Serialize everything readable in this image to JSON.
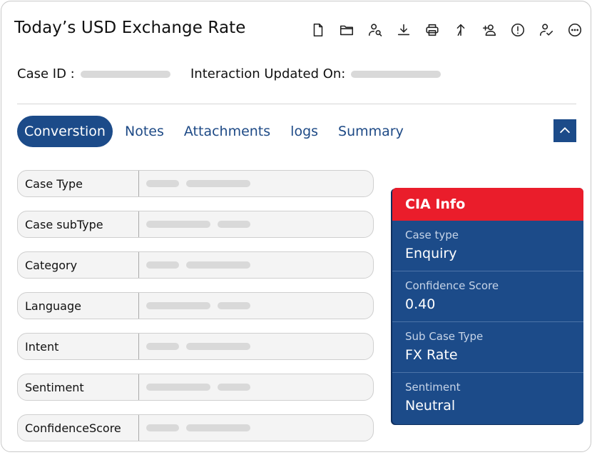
{
  "header": {
    "title": "Today’s USD Exchange Rate",
    "tools": [
      "document-icon",
      "folder-icon",
      "search-user-icon",
      "download-icon",
      "print-icon",
      "merge-icon",
      "add-user-icon",
      "alert-icon",
      "user-check-icon",
      "more-icon"
    ]
  },
  "meta": {
    "case_id_label": "Case ID :",
    "updated_label": "Interaction Updated On:"
  },
  "tabs": [
    {
      "label": "Converstion",
      "active": true
    },
    {
      "label": "Notes"
    },
    {
      "label": "Attachments"
    },
    {
      "label": "logs"
    },
    {
      "label": "Summary"
    }
  ],
  "fields": [
    {
      "label": "Case Type"
    },
    {
      "label": "Case subType"
    },
    {
      "label": "Category"
    },
    {
      "label": "Language"
    },
    {
      "label": "Intent"
    },
    {
      "label": "Sentiment"
    },
    {
      "label": "ConfidenceScore"
    }
  ],
  "cia": {
    "title": "CIA Info",
    "items": [
      {
        "key": "Case type",
        "value": "Enquiry"
      },
      {
        "key": "Confidence Score",
        "value": "0.40"
      },
      {
        "key": "Sub Case Type",
        "value": "FX Rate"
      },
      {
        "key": "Sentiment",
        "value": "Neutral"
      }
    ]
  },
  "colors": {
    "accent": "#1c4b89",
    "cia_header": "#ea1d2b",
    "placeholder": "#d9d9d9"
  }
}
